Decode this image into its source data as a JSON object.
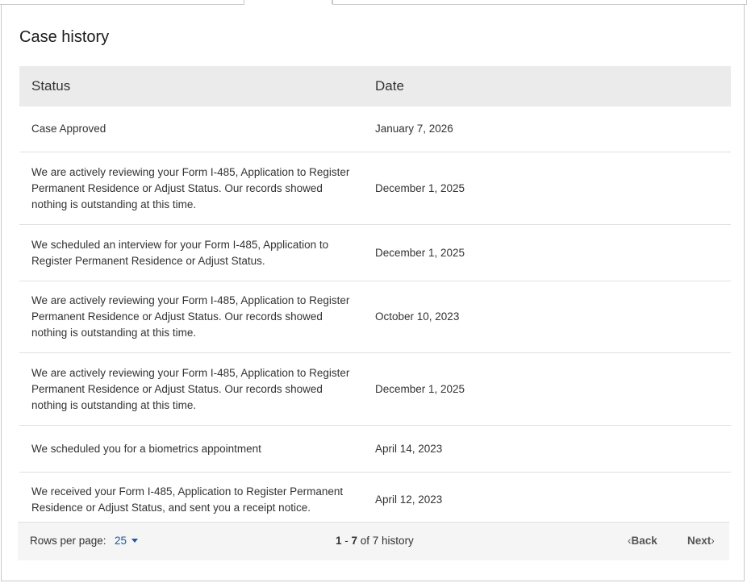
{
  "case_history": {
    "title": "Case history",
    "columns": {
      "status": "Status",
      "date": "Date"
    },
    "rows": [
      {
        "status": "Case Approved",
        "date": "January 7, 2026"
      },
      {
        "status": "We are actively reviewing your Form I-485, Application to Register Permanent Residence or Adjust Status. Our records showed nothing is outstanding at this time.",
        "date": "December 1, 2025"
      },
      {
        "status": "We scheduled an interview for your Form I-485, Application to Register Permanent Residence or Adjust Status.",
        "date": "December 1, 2025"
      },
      {
        "status": "We are actively reviewing your Form I-485, Application to Register Permanent Residence or Adjust Status. Our records showed nothing is outstanding at this time.",
        "date": "October 10, 2023"
      },
      {
        "status": "We are actively reviewing your Form I-485, Application to Register Permanent Residence or Adjust Status. Our records showed nothing is outstanding at this time.",
        "date": "December 1, 2025"
      },
      {
        "status": "We scheduled you for a biometrics appointment",
        "date": "April 14, 2023"
      },
      {
        "status": "We received your Form I-485, Application to Register Permanent Residence or Adjust Status, and sent you a receipt notice.",
        "date": "April 12, 2023"
      }
    ]
  },
  "pagination": {
    "rows_per_page_label": "Rows per page:",
    "rows_per_page_value": "25",
    "range_start": "1",
    "range_sep": " - ",
    "range_end": "7",
    "range_suffix": " of 7 history",
    "back_label": "Back",
    "next_label": "Next"
  },
  "colors": {
    "link": "#1a5aa6",
    "header_bg": "#ebebeb",
    "footer_bg": "#f5f5f5"
  }
}
